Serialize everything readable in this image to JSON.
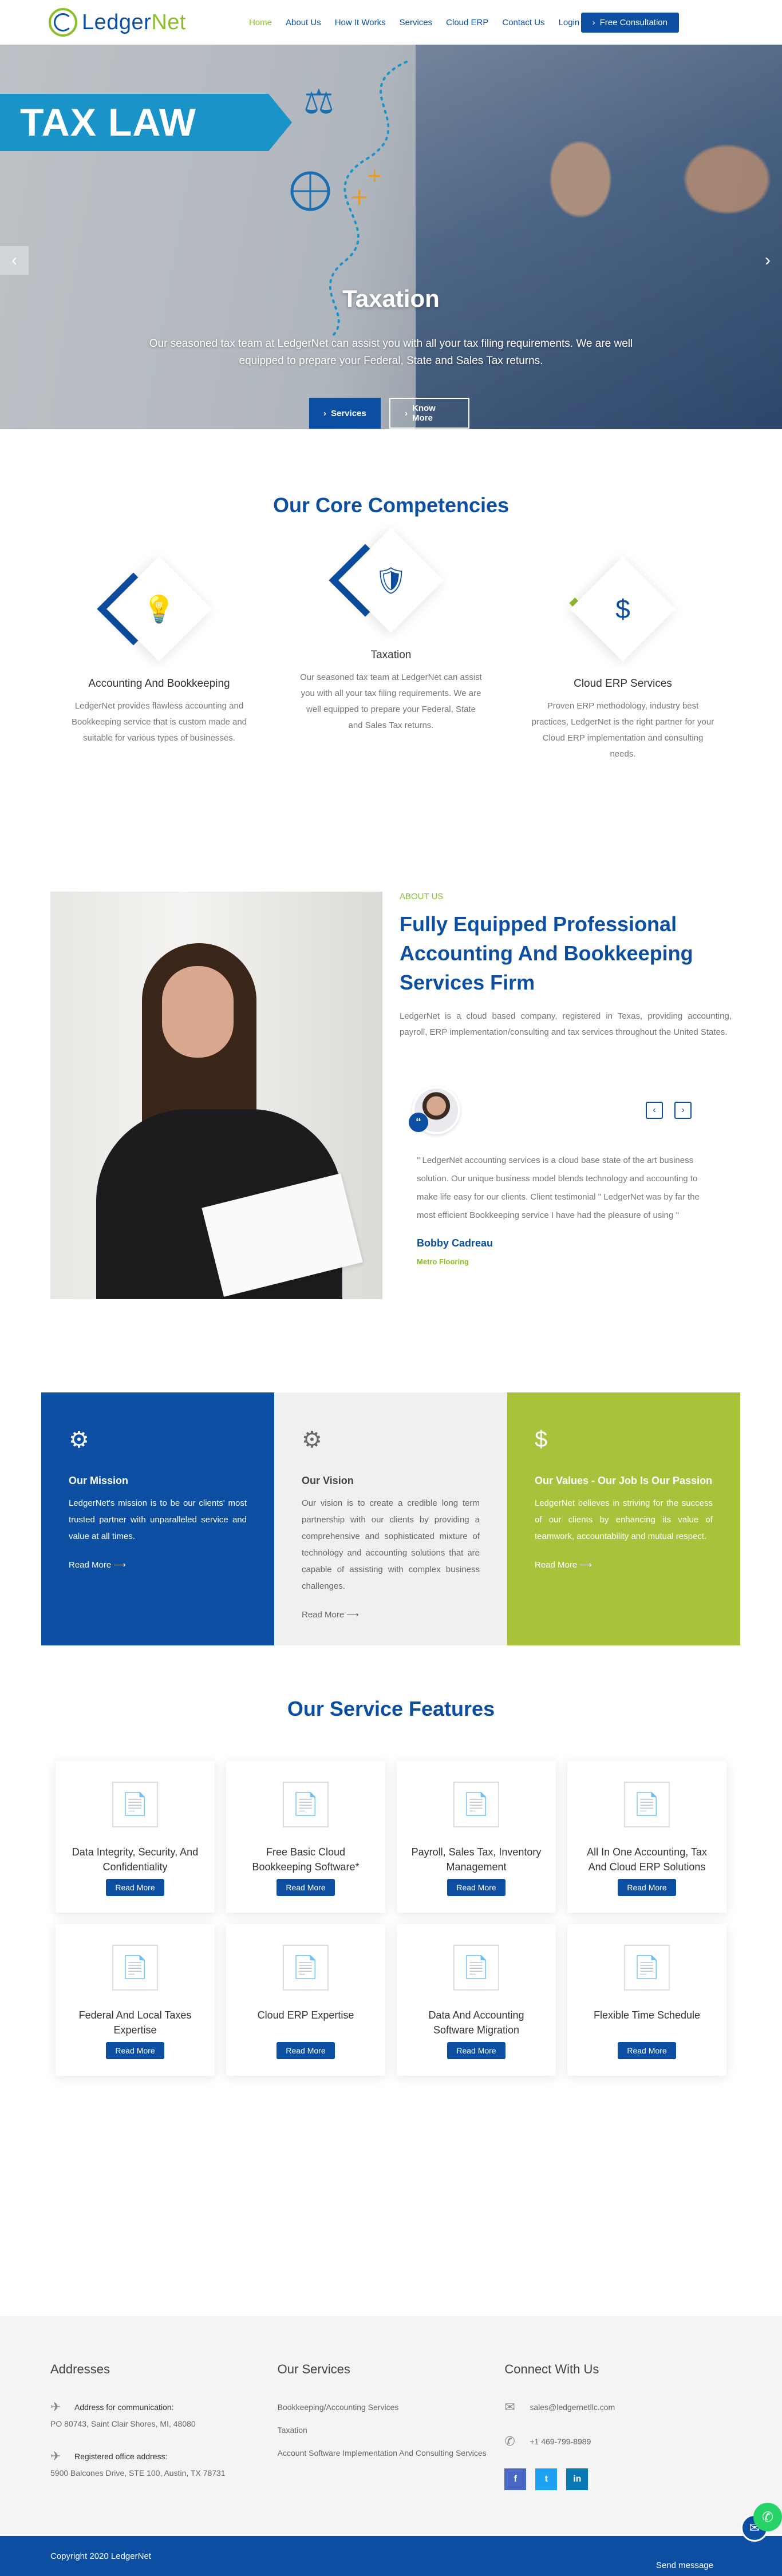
{
  "header": {
    "logo_main": "Ledger",
    "logo_accent": "Net",
    "nav": [
      "Home",
      "About Us",
      "How It Works",
      "Services",
      "Cloud ERP",
      "Contact Us",
      "Login"
    ],
    "cta": "Free Consultation"
  },
  "hero": {
    "ribbon": "TAX LAW",
    "title": "Taxation",
    "subtitle": "Our seasoned tax team at LedgerNet can assist you with all your tax filing requirements. We are well equipped to prepare your Federal, State and Sales Tax returns.",
    "btn_services": "Services",
    "btn_know": "Know More"
  },
  "competencies": {
    "title": "Our Core Competencies",
    "items": [
      {
        "name": "Accounting And Bookkeeping",
        "desc": "LedgerNet provides flawless accounting and Bookkeeping service that is custom made and suitable for various types of businesses.",
        "icon": "bulb-gear-icon"
      },
      {
        "name": "Taxation",
        "desc": "Our seasoned tax team at LedgerNet can assist you with all your tax filing requirements. We are well equipped to prepare your Federal, State and Sales Tax returns.",
        "icon": "dollar-shield-icon"
      },
      {
        "name": "Cloud ERP Services",
        "desc": "Proven ERP methodology, industry best practices, LedgerNet is the right partner for your Cloud ERP implementation and consulting needs.",
        "icon": "dollar-network-icon"
      }
    ]
  },
  "about": {
    "tag": "ABOUT US",
    "title": "Fully Equipped Professional Accounting And Bookkeeping Services Firm",
    "text": "LedgerNet is a cloud based company, registered in Texas, providing accounting, payroll, ERP implementation/consulting and tax services throughout the United States.",
    "testimonial": {
      "quote": "\" LedgerNet accounting services is a cloud base state of the art business solution. Our unique business model blends technology and accounting to make life easy for our clients. Client testimonial \" LedgerNet was by far the most efficient Bookkeeping service I have had the pleasure of using \"",
      "name": "Bobby Cadreau",
      "company": "Metro Flooring"
    }
  },
  "mvv": [
    {
      "title": "Our Mission",
      "text": "LedgerNet's mission is to be our clients' most trusted partner with unparalleled service and value at all times.",
      "link": "Read More"
    },
    {
      "title": "Our Vision",
      "text": "Our vision is to create a credible long term partnership with our clients by providing a comprehensive and sophisticated mixture of technology and accounting solutions that are capable of assisting with complex business challenges.",
      "link": "Read More"
    },
    {
      "title": "Our Values - Our Job Is Our Passion",
      "text": "LedgerNet believes in striving for the success of our clients by enhancing its value of teamwork, accountability and mutual respect.",
      "link": "Read More"
    }
  ],
  "features": {
    "title": "Our Service Features",
    "button": "Read More",
    "items": [
      "Data Integrity, Security, And Confidentiality",
      "Free Basic Cloud Bookkeeping Software*",
      "Payroll, Sales Tax, Inventory Management",
      "All In One Accounting, Tax And Cloud ERP Solutions",
      "Federal And Local Taxes Expertise",
      "Cloud ERP Expertise",
      "Data And Accounting Software Migration",
      "Flexible Time Schedule"
    ]
  },
  "footer": {
    "addresses_title": "Addresses",
    "addr1_label": "Address for communication:",
    "addr1": "PO 80743, Saint Clair Shores, MI, 48080",
    "addr2_label": "Registered office address:",
    "addr2": "5900 Balcones Drive, STE 100, Austin, TX 78731",
    "services_title": "Our Services",
    "services": [
      "Bookkeeping/Accounting Services",
      "Taxation",
      "Account Software Implementation And Consulting Services"
    ],
    "connect_title": "Connect With Us",
    "email": "sales@ledgernetllc.com",
    "phone": "+1 469-799-8989",
    "copyright": "Copyright 2020 LedgerNet",
    "send": "Send message"
  },
  "colors": {
    "brand_blue": "#0b4ea2",
    "brand_green": "#8cbe2a",
    "values_green": "#a8c23c"
  }
}
